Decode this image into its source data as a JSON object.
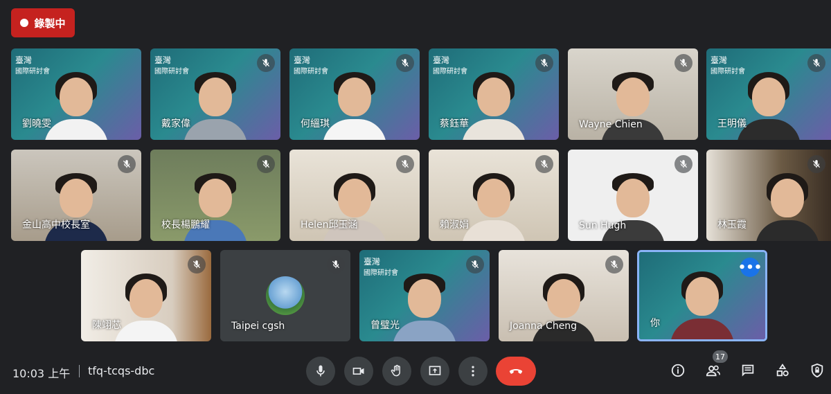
{
  "recording": {
    "label": "錄製中"
  },
  "meeting": {
    "time": "10:03 上午",
    "code": "tfq-tcqs-dbc"
  },
  "banner": {
    "line1": "臺灣",
    "line2": "國際研討會"
  },
  "participants_count": "17",
  "participants": [
    {
      "name": "劉曉雯",
      "muted": false
    },
    {
      "name": "戴家偉",
      "muted": true
    },
    {
      "name": "何縕琪",
      "muted": true
    },
    {
      "name": "蔡鈺華",
      "muted": true
    },
    {
      "name": "Wayne Chien",
      "muted": true
    },
    {
      "name": "王明儀",
      "muted": true
    },
    {
      "name": "金山高中校長室",
      "muted": true
    },
    {
      "name": "校長楊鵬耀",
      "muted": true
    },
    {
      "name": "Helen邱玉涵",
      "muted": true
    },
    {
      "name": "賴淑娟",
      "muted": true
    },
    {
      "name": "Sun Hugh",
      "muted": true
    },
    {
      "name": "林玉霞",
      "muted": true
    },
    {
      "name": "陳翊芯",
      "muted": true
    },
    {
      "name": "Taipei cgsh",
      "muted": true
    },
    {
      "name": "曾璧光",
      "muted": true
    },
    {
      "name": "Joanna Cheng",
      "muted": true
    },
    {
      "name": "你",
      "muted": false
    }
  ],
  "controls": {
    "mic": "microphone-icon",
    "camera": "camera-icon",
    "raise_hand": "hand-icon",
    "present": "present-screen-icon",
    "more": "more-options-icon",
    "end": "end-call-icon",
    "info": "info-icon",
    "people": "people-icon",
    "chat": "chat-icon",
    "activities": "activities-icon",
    "host": "host-controls-icon"
  },
  "colors": {
    "accent": "#1a73e8",
    "record": "#c5221f",
    "end_call": "#ea4335"
  }
}
